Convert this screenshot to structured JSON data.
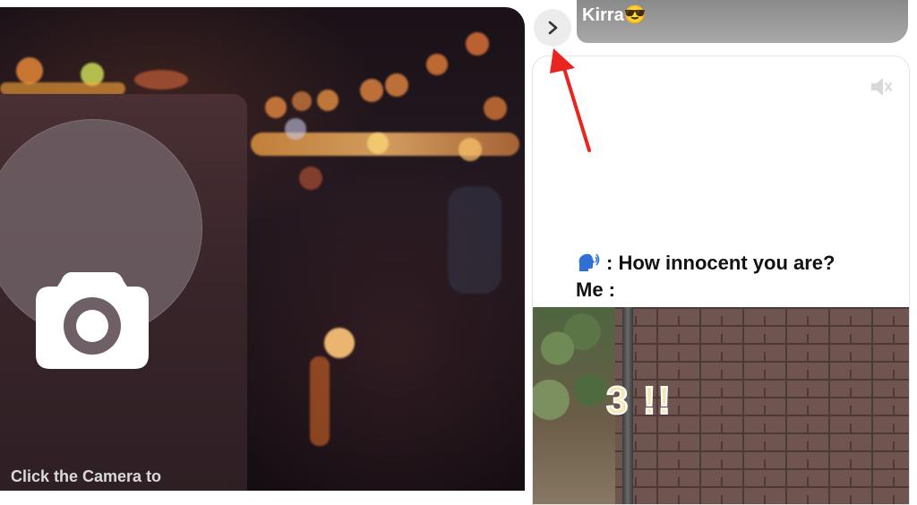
{
  "camera_panel": {
    "hint_text": "Click the Camera to",
    "icon": "camera-icon"
  },
  "right_panel": {
    "expand_button_icon": "chevron-right-icon",
    "sender_name": "Kirra😎",
    "mute_icon": "speaker-muted-icon",
    "caption_line1": ": How innocent you are?",
    "caption_line2": "Me :",
    "caption_emoji": "speaking-head-icon",
    "photo_overlay_text": "3 !!"
  },
  "annotation": {
    "arrow_color": "#e8261f"
  }
}
